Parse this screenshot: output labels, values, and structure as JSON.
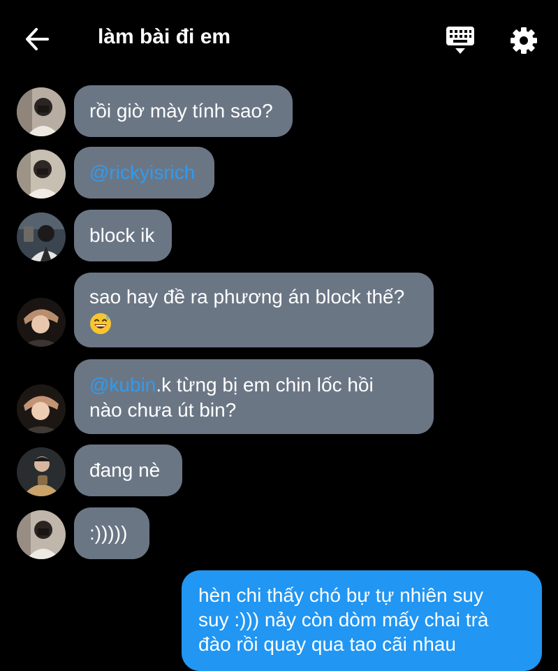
{
  "header": {
    "back_icon": "arrow-left-icon",
    "title": "làm bài đi em",
    "keyboard_icon": "keyboard-icon",
    "settings_icon": "gear-icon"
  },
  "colors": {
    "background": "#000000",
    "received_bubble": "#6b7685",
    "sent_bubble": "#2196f3",
    "mention": "#2f9bef"
  },
  "messages": [
    {
      "sender": "other",
      "lines": [
        "rồi giờ mày tính sao?"
      ]
    },
    {
      "sender": "other",
      "mention": "@rickyisrich"
    },
    {
      "sender": "other",
      "lines": [
        "block ik"
      ]
    },
    {
      "sender": "other",
      "lines": [
        "sao hay đề ra phương án block thế?"
      ],
      "emoji": "grinning-sweat-emoji"
    },
    {
      "sender": "other",
      "mention": "@kubin",
      "lines": [
        ".k từng bị em chin lốc hồi",
        "nào chưa út bin?"
      ]
    },
    {
      "sender": "other",
      "lines": [
        "đang nè"
      ]
    },
    {
      "sender": "other",
      "lines": [
        ":)))))"
      ]
    },
    {
      "sender": "me",
      "lines": [
        "hèn chi thấy chó bự tự nhiên suy",
        "suy :))) nảy còn dòm mấy chai trà",
        "đào rồi quay qua tao cãi nhau"
      ]
    }
  ]
}
